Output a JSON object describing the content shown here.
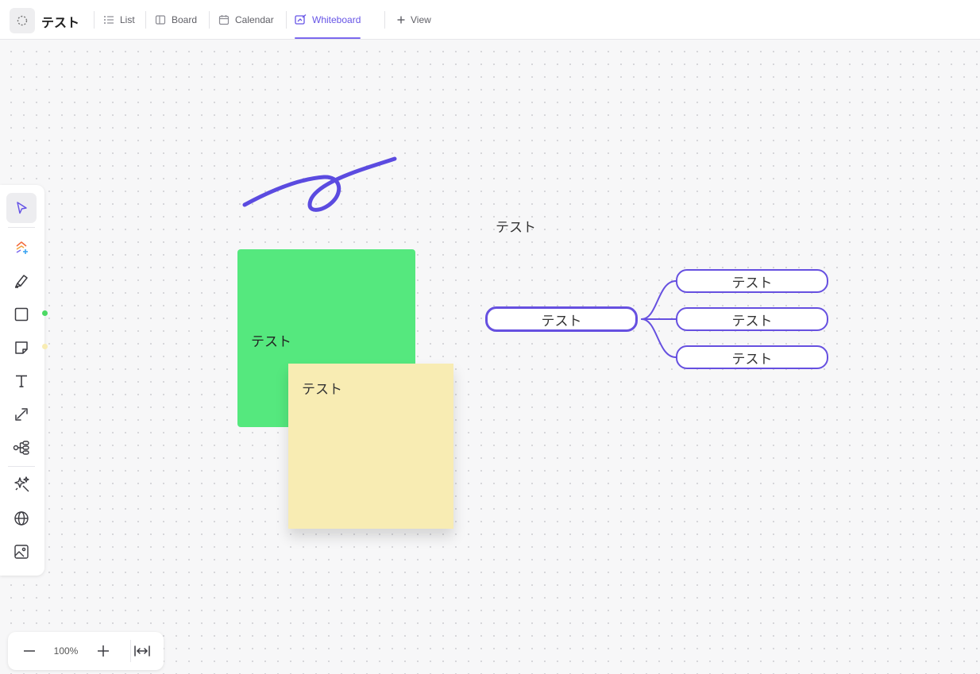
{
  "header": {
    "space_title": "テスト",
    "space_icon": "dashed-circle-icon",
    "tabs": [
      {
        "label": "List",
        "icon": "list-icon"
      },
      {
        "label": "Board",
        "icon": "board-icon"
      },
      {
        "label": "Calendar",
        "icon": "calendar-icon"
      },
      {
        "label": "Whiteboard",
        "icon": "whiteboard-icon",
        "active": true
      }
    ],
    "add_view_label": "View"
  },
  "toolbar": {
    "tools": [
      {
        "name": "select",
        "icon": "pointer-icon",
        "selected": true
      },
      {
        "name": "ai-templates",
        "icon": "sparkle-shapes-icon"
      },
      {
        "name": "pen",
        "icon": "pen-icon"
      },
      {
        "name": "shape",
        "icon": "square-icon",
        "dot_color": "#4cd964"
      },
      {
        "name": "sticky-note",
        "icon": "sticky-note-icon",
        "dot_color": "#f8ecb3"
      },
      {
        "name": "text",
        "icon": "text-icon"
      },
      {
        "name": "connector",
        "icon": "connector-icon"
      },
      {
        "name": "mind-map",
        "icon": "mind-map-icon"
      },
      {
        "name": "ai",
        "icon": "magic-stars-icon"
      },
      {
        "name": "embed",
        "icon": "globe-icon"
      },
      {
        "name": "image",
        "icon": "image-icon"
      }
    ]
  },
  "zoom": {
    "level": "100%"
  },
  "board": {
    "green_note": {
      "text": "テスト",
      "color": "#55e87e"
    },
    "yellow_note": {
      "text": "テスト",
      "color": "#f8ecb3"
    },
    "free_text": "テスト",
    "stroke_color": "#5b4be0",
    "mind_map": {
      "root": "テスト",
      "children": [
        "テスト",
        "テスト",
        "テスト"
      ],
      "color": "#6650e0"
    }
  },
  "colors": {
    "accent": "#7b68ee"
  }
}
